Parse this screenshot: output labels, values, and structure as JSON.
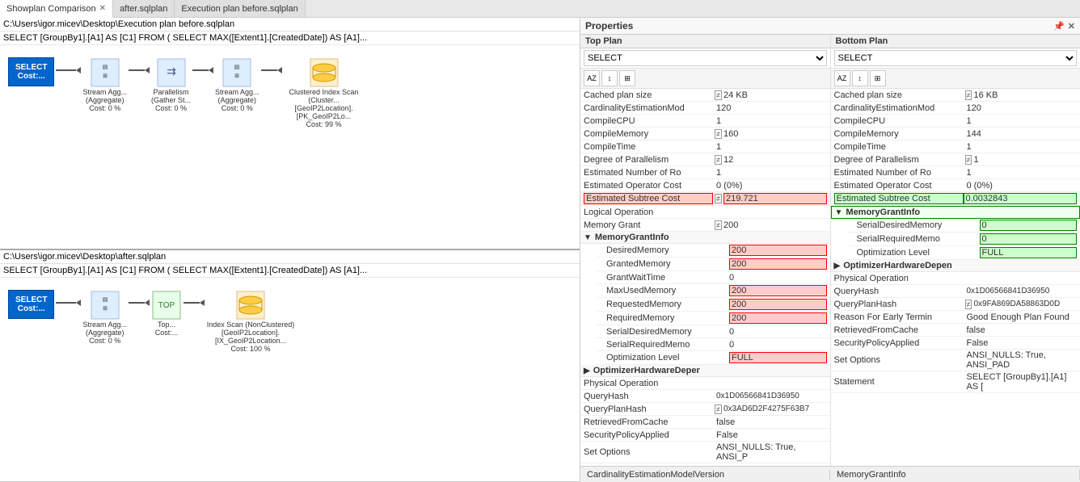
{
  "tabs": [
    {
      "id": "showplan",
      "label": "Showplan Comparison",
      "active": true,
      "closeable": true
    },
    {
      "id": "after",
      "label": "after.sqlplan",
      "active": false,
      "closeable": false
    },
    {
      "id": "before",
      "label": "Execution plan before.sqlplan",
      "active": false,
      "closeable": false
    }
  ],
  "left_panel": {
    "top_plan": {
      "path": "C:\\Users\\igor.micev\\Desktop\\Execution plan before.sqlplan",
      "query": "SELECT [GroupBy1].[A1] AS [C1] FROM ( SELECT MAX([Extent1].[CreatedDate]) AS [A1]...",
      "nodes": [
        {
          "type": "select",
          "label": "SELECT\nCost:...",
          "cost": ""
        },
        {
          "type": "stream_agg",
          "label": "Stream Agg...\n(Aggregate)\nCost: 0 %"
        },
        {
          "type": "parallelism",
          "label": "Parallelism\n(Gather St...\nCost: 0 %"
        },
        {
          "type": "stream_agg2",
          "label": "Stream Agg...\n(Aggregate)\nCost: 0 %"
        },
        {
          "type": "clustered_scan",
          "label": "Clustered Index Scan (Cluster...\n[GeoIP2Location].[PK_GeoIP2Lo...\nCost: 99 %"
        }
      ]
    },
    "bottom_plan": {
      "path": "C:\\Users\\igor.micev\\Desktop\\after.sqlplan",
      "query": "SELECT [GroupBy1].[A1] AS [C1] FROM ( SELECT MAX([Extent1].[CreatedDate]) AS [A1]...",
      "nodes": [
        {
          "type": "select",
          "label": "SELECT\nCost:...",
          "cost": ""
        },
        {
          "type": "stream_agg",
          "label": "Stream Agg...\n(Aggregate)\nCost: 0 %"
        },
        {
          "type": "top",
          "label": "Top...\nCost:..."
        },
        {
          "type": "index_scan",
          "label": "Index Scan (NonClustered)\n[GeoIP2Location].[IX_GeoIP2Location...\nCost: 100 %"
        }
      ]
    }
  },
  "properties": {
    "title": "Properties",
    "top_plan": {
      "label": "Top Plan",
      "select_value": "SELECT",
      "rows": [
        {
          "name": "Cached plan size",
          "indicator": "≠",
          "value": "24 KB",
          "highlight": ""
        },
        {
          "name": "CardinalityEstimationMod",
          "indicator": "",
          "value": "120",
          "highlight": ""
        },
        {
          "name": "CompileCPU",
          "indicator": "",
          "value": "1",
          "highlight": ""
        },
        {
          "name": "CompileMemory",
          "indicator": "≠",
          "value": "160",
          "highlight": ""
        },
        {
          "name": "CompileTime",
          "indicator": "",
          "value": "1",
          "highlight": ""
        },
        {
          "name": "Degree of Parallelism",
          "indicator": "≠",
          "value": "12",
          "highlight": ""
        },
        {
          "name": "Estimated Number of Ro",
          "indicator": "",
          "value": "1",
          "highlight": ""
        },
        {
          "name": "Estimated Operator Cost",
          "indicator": "",
          "value": "0 (0%)",
          "highlight": ""
        },
        {
          "name": "Estimated Subtree Cost",
          "indicator": "≠",
          "value": "219.721",
          "highlight": "red"
        },
        {
          "name": "Logical Operation",
          "indicator": "",
          "value": "",
          "highlight": ""
        },
        {
          "name": "Memory Grant",
          "indicator": "≠",
          "value": "200",
          "highlight": ""
        }
      ],
      "memory_grant_info": {
        "label": "MemoryGrantInfo",
        "rows": [
          {
            "name": "DesiredMemory",
            "value": "200",
            "highlight": "red"
          },
          {
            "name": "GrantedMemory",
            "value": "200",
            "highlight": "red"
          },
          {
            "name": "GrantWaitTime",
            "value": "0",
            "highlight": ""
          },
          {
            "name": "MaxUsedMemory",
            "value": "200",
            "highlight": "red"
          },
          {
            "name": "RequestedMemory",
            "value": "200",
            "highlight": "red"
          },
          {
            "name": "RequiredMemory",
            "value": "200",
            "highlight": "red"
          },
          {
            "name": "SerialDesiredMemory",
            "value": "0",
            "highlight": ""
          },
          {
            "name": "SerialRequiredMemo",
            "value": "0",
            "highlight": ""
          },
          {
            "name": "Optimization Level",
            "value": "FULL",
            "highlight": "red"
          }
        ]
      },
      "optimizer_hardware": {
        "label": "OptimizerHardwareDeper"
      },
      "bottom_rows": [
        {
          "name": "Physical Operation",
          "indicator": "",
          "value": "",
          "highlight": ""
        },
        {
          "name": "QueryHash",
          "indicator": "",
          "value": "0x1D06566841D36950",
          "highlight": ""
        },
        {
          "name": "QueryPlanHash",
          "indicator": "≠",
          "value": "0x3AD6D2F4275F63B7",
          "highlight": ""
        },
        {
          "name": "RetrievedFromCache",
          "indicator": "",
          "value": "false",
          "highlight": ""
        },
        {
          "name": "SecurityPolicyApplied",
          "indicator": "",
          "value": "False",
          "highlight": ""
        },
        {
          "name": "Set Options",
          "indicator": "",
          "value": "ANSI_NULLS: True, ANSI_P",
          "highlight": ""
        }
      ]
    },
    "bottom_plan": {
      "label": "Bottom Plan",
      "select_value": "SELECT",
      "rows": [
        {
          "name": "Cached plan size",
          "indicator": "≠",
          "value": "16 KB",
          "highlight": ""
        },
        {
          "name": "CardinalityEstimationMod",
          "indicator": "",
          "value": "120",
          "highlight": ""
        },
        {
          "name": "CompileCPU",
          "indicator": "",
          "value": "1",
          "highlight": ""
        },
        {
          "name": "CompileMemory",
          "indicator": "",
          "value": "144",
          "highlight": ""
        },
        {
          "name": "CompileTime",
          "indicator": "",
          "value": "1",
          "highlight": ""
        },
        {
          "name": "Degree of Parallelism",
          "indicator": "≠",
          "value": "1",
          "highlight": ""
        },
        {
          "name": "Estimated Number of Ro",
          "indicator": "",
          "value": "1",
          "highlight": ""
        },
        {
          "name": "Estimated Operator Cost",
          "indicator": "",
          "value": "0 (0%)",
          "highlight": ""
        },
        {
          "name": "Estimated Subtree Cost",
          "indicator": "",
          "value": "0.0032843",
          "highlight": "green"
        }
      ],
      "memory_grant_info": {
        "label": "MemoryGrantInfo",
        "rows": [
          {
            "name": "SerialDesiredMemory",
            "value": "0",
            "highlight": "green"
          },
          {
            "name": "SerialRequiredMemo",
            "value": "0",
            "highlight": "green"
          },
          {
            "name": "Optimization Level",
            "value": "FULL",
            "highlight": "green"
          }
        ]
      },
      "optimizer_hardware": {
        "label": "OptimizerHardwareDepen"
      },
      "bottom_rows": [
        {
          "name": "Physical Operation",
          "indicator": "",
          "value": "",
          "highlight": ""
        },
        {
          "name": "QueryHash",
          "indicator": "",
          "value": "0x1D06566841D36950",
          "highlight": ""
        },
        {
          "name": "QueryPlanHash",
          "indicator": "≠",
          "value": "0x9FA869DA58863D0D",
          "highlight": ""
        },
        {
          "name": "Reason For Early Termin",
          "indicator": "",
          "value": "Good Enough Plan Found",
          "highlight": ""
        },
        {
          "name": "RetrievedFromCache",
          "indicator": "",
          "value": "false",
          "highlight": ""
        },
        {
          "name": "SecurityPolicyApplied",
          "indicator": "",
          "value": "False",
          "highlight": ""
        },
        {
          "name": "Set Options",
          "indicator": "",
          "value": "ANSI_NULLS: True, ANSI_PAD",
          "highlight": ""
        },
        {
          "name": "Statement",
          "indicator": "",
          "value": "SELECT   [GroupBy1].[A1] AS [",
          "highlight": ""
        }
      ]
    }
  },
  "status_bar": {
    "left": "CardinalityEstimationModelVersion",
    "right": "MemoryGrantInfo"
  }
}
